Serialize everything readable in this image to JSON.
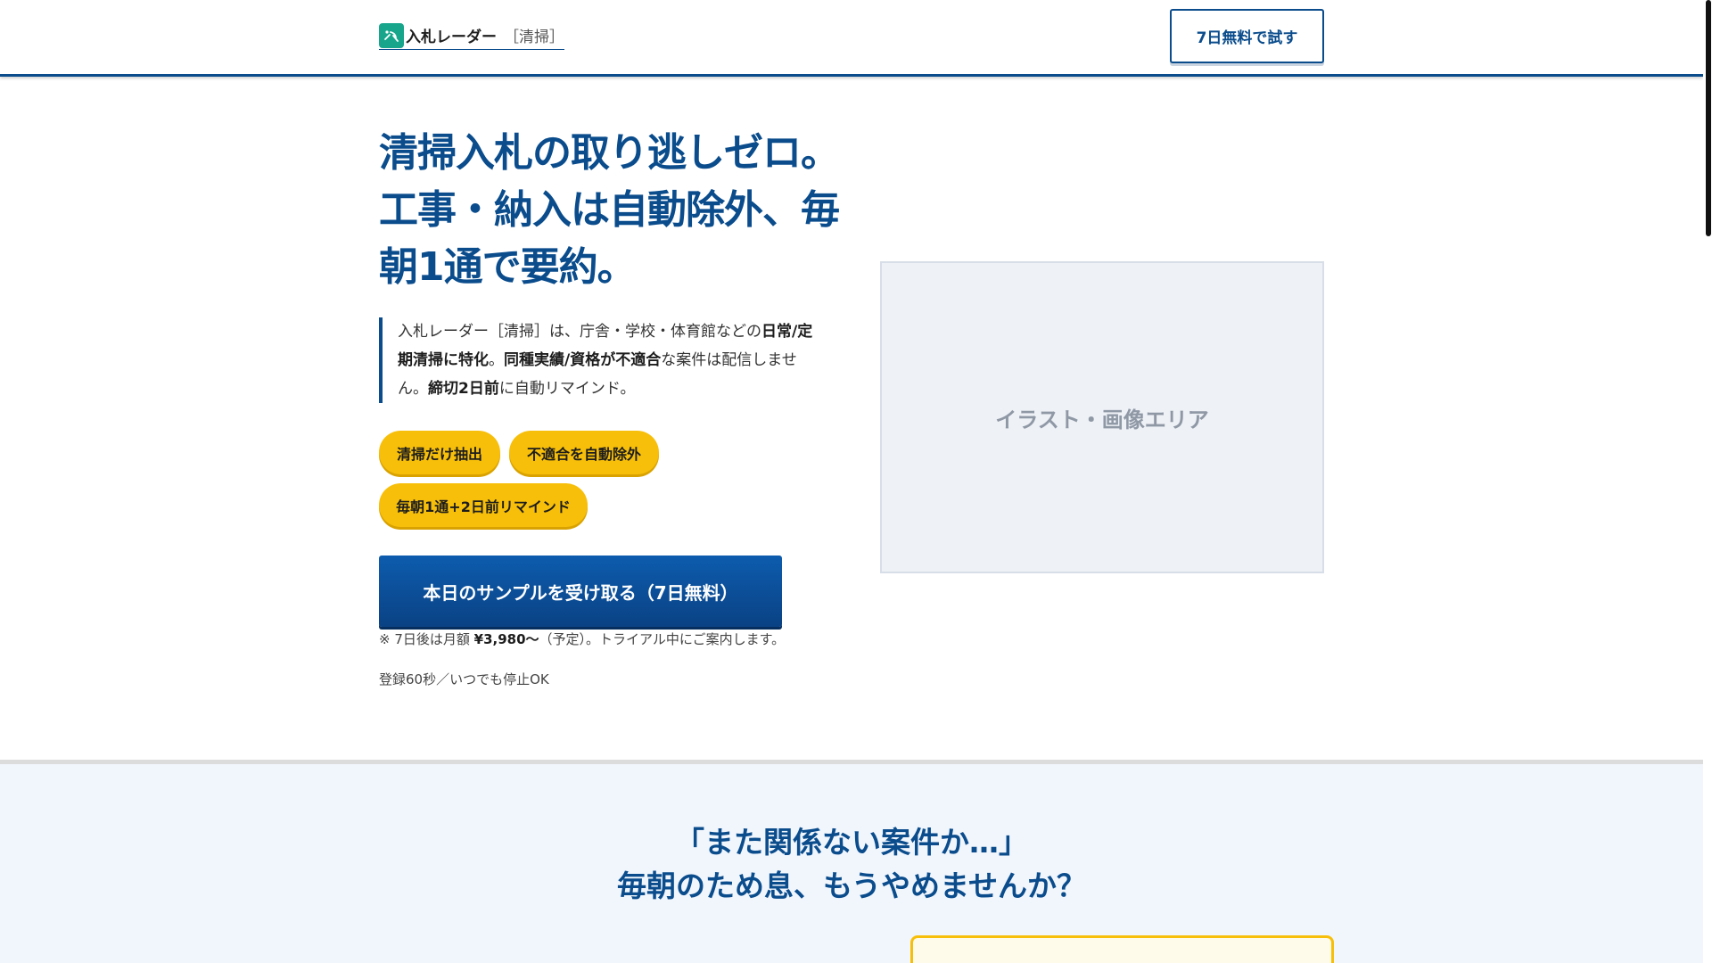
{
  "header": {
    "brand_name": "入札レーダー",
    "brand_tag": "［清掃］",
    "cta_label": "7日無料で試す",
    "logo_icon": "radar-icon"
  },
  "hero": {
    "title": "清掃入札の取り逃しゼロ。工事・納入は自動除外、毎朝1通で要約。",
    "desc": {
      "p1": "入札レーダー［清掃］は、庁舎・学校・体育館などの",
      "b1": "日常/定期清掃に特化",
      "p2": "。",
      "b2": "同種実績/資格が不適合",
      "p3": "な案件は配信しません。",
      "b3": "締切2日前",
      "p4": "に自動リマインド。"
    },
    "chips": [
      "清掃だけ抽出",
      "不適合を自動除外",
      "毎朝1通+2日前リマインド"
    ],
    "cta_label": "本日のサンプルを受け取る（7日無料）",
    "price_note": {
      "prefix": "※ 7日後は月額 ",
      "price": "¥3,980〜",
      "suffix": "（予定）。トライアル中にご案内します。"
    },
    "register_note": "登録60秒／いつでも停止OK",
    "image_placeholder": "イラスト・画像エリア"
  },
  "section2": {
    "title_line1": "「また関係ない案件か…」",
    "title_line2": "毎朝のため息、もうやめませんか？"
  },
  "colors": {
    "primary": "#0a4c8c",
    "accent": "#f7bf0a",
    "logo": "#17a58c",
    "section_bg": "#f1f6fd"
  }
}
